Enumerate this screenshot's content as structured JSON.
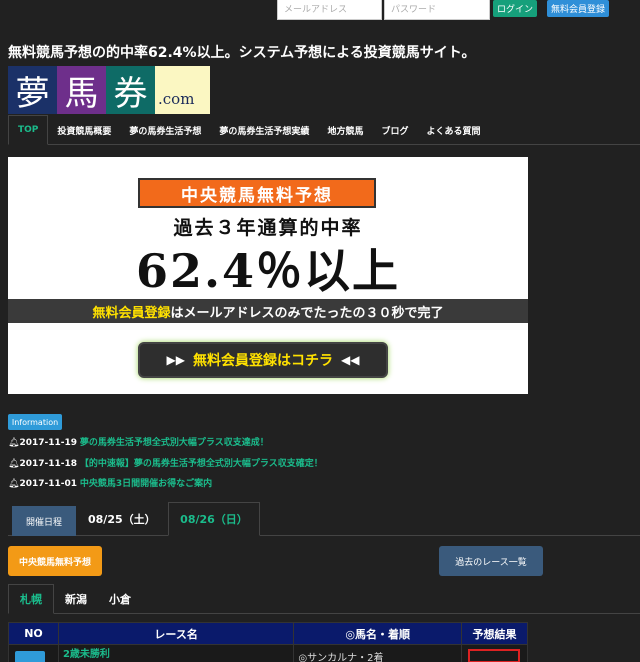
{
  "login": {
    "email_placeholder": "メールアドレス",
    "password_placeholder": "パスワード",
    "login_label": "ログイン",
    "register_label": "無料会員登録"
  },
  "tagline": "無料競馬予想の的中率62.4%以上。システム予想による投資競馬サイト。",
  "logo": {
    "char1": "夢",
    "char2": "馬",
    "char3": "券",
    "suffix": ".com"
  },
  "nav": [
    {
      "label": "TOP",
      "active": true
    },
    {
      "label": "投資競馬概要"
    },
    {
      "label": "夢の馬券生活予想"
    },
    {
      "label": "夢の馬券生活予想実績"
    },
    {
      "label": "地方競馬"
    },
    {
      "label": "ブログ"
    },
    {
      "label": "よくある質問"
    }
  ],
  "banner": {
    "headline": "中央競馬無料予想",
    "line2": "過去３年通算的中率",
    "line3": "62.4％以上",
    "band_highlight": "無料会員登録",
    "band_rest": "はメールアドレスのみでたったの３０秒で完了",
    "button_arrow_left": "▶▶",
    "button_label": "無料会員登録はコチラ",
    "button_arrow_right": "◀◀"
  },
  "info_label": "Information",
  "news": [
    {
      "date": "2017-11-19",
      "text": "夢の馬券生活予想全式別大幅プラス収支達成！"
    },
    {
      "date": "2017-11-18",
      "text": "【的中速報】夢の馬券生活予想全式別大幅プラス収支確定！"
    },
    {
      "date": "2017-11-01",
      "text": "中央競馬3日間開催お得なご案内"
    }
  ],
  "schedule": {
    "label": "開催日程",
    "date1": "08/25（土）",
    "date2": "08/26（日）"
  },
  "buttons": {
    "free_prediction": "中央競馬無料予想",
    "past_races": "過去のレース一覧"
  },
  "venues": [
    {
      "label": "札幌",
      "active": true
    },
    {
      "label": "新潟"
    },
    {
      "label": "小倉"
    }
  ],
  "table": {
    "headers": [
      "NO",
      "レース名",
      "◎馬名・着順",
      "予想結果"
    ],
    "first_row": {
      "race": "2歳未勝利",
      "horse": "◎サンカルナ・2着"
    }
  }
}
